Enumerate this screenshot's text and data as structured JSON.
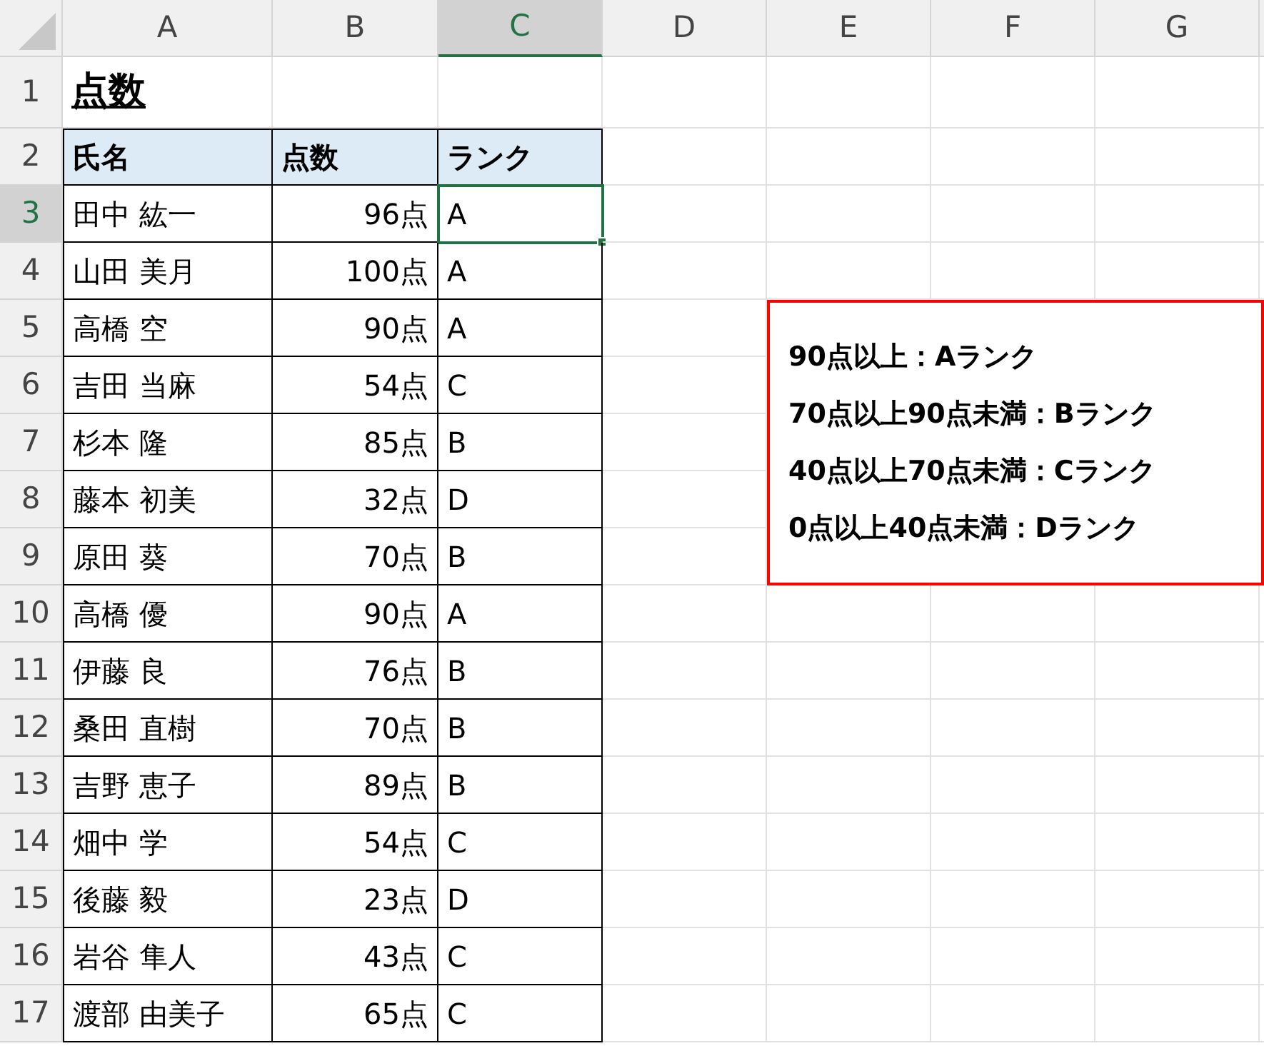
{
  "column_headers": [
    {
      "label": "A",
      "selected": false
    },
    {
      "label": "B",
      "selected": false
    },
    {
      "label": "C",
      "selected": true
    },
    {
      "label": "D",
      "selected": false
    },
    {
      "label": "E",
      "selected": false
    },
    {
      "label": "F",
      "selected": false
    },
    {
      "label": "G",
      "selected": false
    }
  ],
  "row_numbers": [
    {
      "label": "1",
      "selected": false
    },
    {
      "label": "2",
      "selected": false
    },
    {
      "label": "3",
      "selected": true
    },
    {
      "label": "4",
      "selected": false
    },
    {
      "label": "5",
      "selected": false
    },
    {
      "label": "6",
      "selected": false
    },
    {
      "label": "7",
      "selected": false
    },
    {
      "label": "8",
      "selected": false
    },
    {
      "label": "9",
      "selected": false
    },
    {
      "label": "10",
      "selected": false
    },
    {
      "label": "11",
      "selected": false
    },
    {
      "label": "12",
      "selected": false
    },
    {
      "label": "13",
      "selected": false
    },
    {
      "label": "14",
      "selected": false
    },
    {
      "label": "15",
      "selected": false
    },
    {
      "label": "16",
      "selected": false
    },
    {
      "label": "17",
      "selected": false
    }
  ],
  "title": "点数",
  "table": {
    "columns": [
      "氏名",
      "点数",
      "ランク"
    ],
    "rows": [
      {
        "name": "田中 紘一",
        "score": "96点",
        "rank": "A"
      },
      {
        "name": "山田 美月",
        "score": "100点",
        "rank": "A"
      },
      {
        "name": "高橋 空",
        "score": "90点",
        "rank": "A"
      },
      {
        "name": "吉田 当麻",
        "score": "54点",
        "rank": "C"
      },
      {
        "name": "杉本 隆",
        "score": "85点",
        "rank": "B"
      },
      {
        "name": "藤本 初美",
        "score": "32点",
        "rank": "D"
      },
      {
        "name": "原田 葵",
        "score": "70点",
        "rank": "B"
      },
      {
        "name": "高橋 優",
        "score": "90点",
        "rank": "A"
      },
      {
        "name": "伊藤 良",
        "score": "76点",
        "rank": "B"
      },
      {
        "name": "桑田 直樹",
        "score": "70点",
        "rank": "B"
      },
      {
        "name": "吉野 恵子",
        "score": "89点",
        "rank": "B"
      },
      {
        "name": "畑中 学",
        "score": "54点",
        "rank": "C"
      },
      {
        "name": "後藤 毅",
        "score": "23点",
        "rank": "D"
      },
      {
        "name": "岩谷 隼人",
        "score": "43点",
        "rank": "C"
      },
      {
        "name": "渡部 由美子",
        "score": "65点",
        "rank": "C"
      }
    ]
  },
  "note_box": {
    "lines": [
      "90点以上：Aランク",
      "70点以上90点未満：Bランク",
      "40点以上70点未満：Cランク",
      "0点以上40点未満：Dランク"
    ]
  }
}
